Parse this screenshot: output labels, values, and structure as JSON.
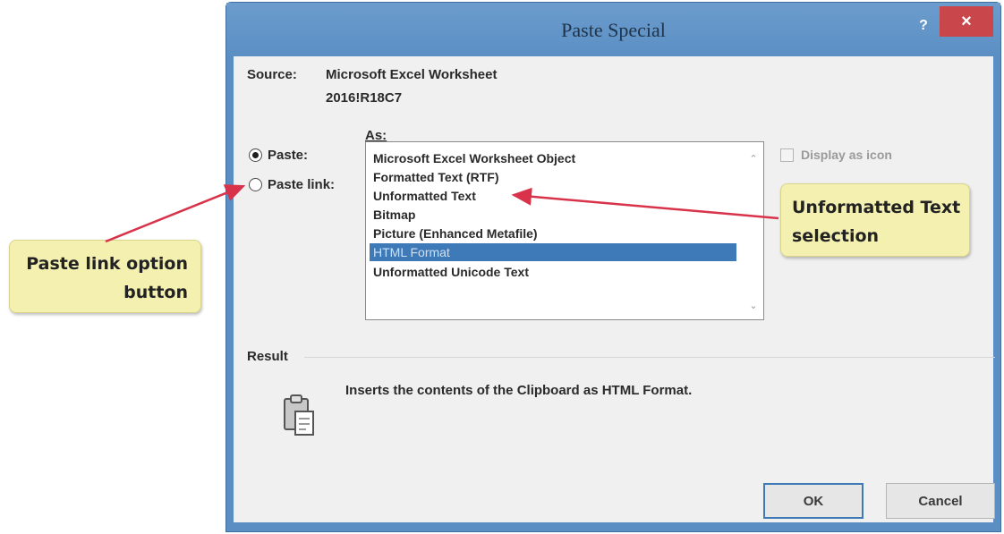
{
  "window": {
    "title": "Paste Special",
    "help_label": "?",
    "close_label": "×"
  },
  "source": {
    "label": "Source:",
    "value": "Microsoft Excel Worksheet",
    "item": "2016!R18C7"
  },
  "options": {
    "paste_label": "Paste:",
    "paste_link_label": "Paste link:",
    "selected": "Paste:"
  },
  "as_label": "As:",
  "formats": [
    "Microsoft Excel Worksheet Object",
    "Formatted Text (RTF)",
    "Unformatted Text",
    "Bitmap",
    "Picture (Enhanced Metafile)",
    "HTML Format",
    "Unformatted Unicode Text"
  ],
  "selected_format": "HTML Format",
  "display_as_icon": {
    "label": "Display as icon",
    "checked": false,
    "enabled": false
  },
  "result": {
    "label": "Result",
    "text": "Inserts the contents of the Clipboard as HTML Format."
  },
  "buttons": {
    "ok": "OK",
    "cancel": "Cancel"
  },
  "callouts": {
    "paste_link": [
      "Paste link option",
      "button"
    ],
    "unformatted": [
      "Unformatted Text",
      "selection"
    ]
  },
  "colors": {
    "title_bar": "#5b8fc4",
    "close_button": "#c9464a",
    "selection": "#3e7ab8",
    "callout_fill": "#f4f1b0",
    "arrow": "#d8334a"
  },
  "icons": {
    "result": "clipboard-paste-icon"
  }
}
